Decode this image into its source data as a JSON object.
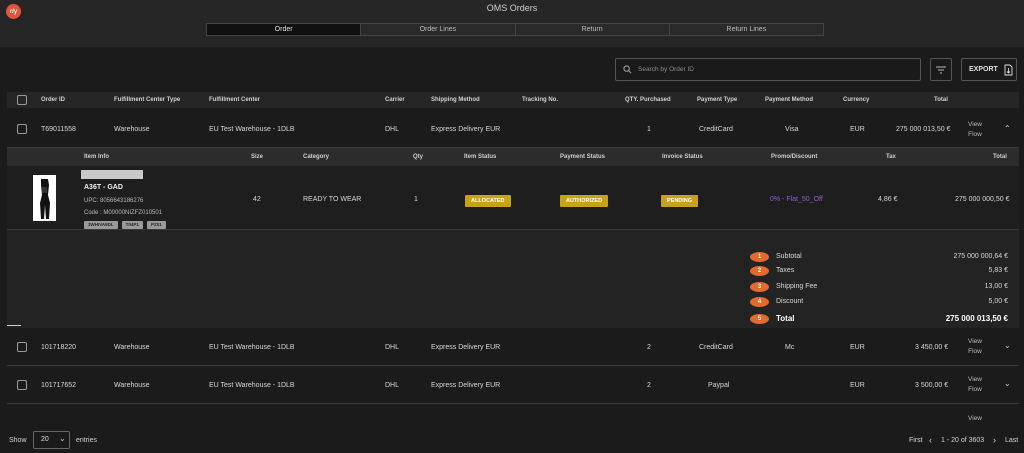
{
  "app": {
    "logo": "r/y",
    "title": "OMS Orders"
  },
  "tabs": [
    "Order",
    "Order Lines",
    "Return",
    "Return Lines"
  ],
  "search": {
    "placeholder": "Search by Order ID"
  },
  "export_label": "EXPORT",
  "columns": {
    "order_id": "Order ID",
    "fc_type": "Fulfillment Center Type",
    "fc": "Fulfillment Center",
    "carrier": "Carrier",
    "shipping": "Shipping Method",
    "tracking": "Tracking No.",
    "qty": "QTY. Purchased",
    "payment_type": "Payment Type",
    "payment_method": "Payment Method",
    "currency": "Currency",
    "total": "Total"
  },
  "orders": [
    {
      "id": "T69011558",
      "fc_type": "Warehouse",
      "fc": "EU Test Warehouse - 1DLB",
      "carrier": "DHL",
      "shipping": "Express Delivery EUR",
      "tracking": "",
      "qty": "1",
      "payment_type": "CreditCard",
      "payment_method": "Visa",
      "currency": "EUR",
      "total": "275 000 013,50 €",
      "action1": "View",
      "action2": "Flow"
    },
    {
      "id": "101718220",
      "fc_type": "Warehouse",
      "fc": "EU Test Warehouse - 1DLB",
      "carrier": "DHL",
      "shipping": "Express Delivery EUR",
      "tracking": "",
      "qty": "2",
      "payment_type": "CreditCard",
      "payment_method": "Mc",
      "currency": "EUR",
      "total": "3 450,00 €",
      "action1": "View",
      "action2": "Flow"
    },
    {
      "id": "101717652",
      "fc_type": "Warehouse",
      "fc": "EU Test Warehouse - 1DLB",
      "carrier": "DHL",
      "shipping": "Express Delivery EUR",
      "tracking": "",
      "qty": "2",
      "payment_type": "Paypal",
      "payment_method": "",
      "currency": "EUR",
      "total": "3 500,00 €",
      "action1": "View",
      "action2": "Flow"
    }
  ],
  "partial_row_action": "View",
  "line_columns": {
    "item_info": "Item Info",
    "size": "Size",
    "category": "Category",
    "qty": "Qty",
    "item_status": "Item Status",
    "payment_status": "Payment Status",
    "invoice_status": "Invoice Status",
    "promo": "Promo/Discount",
    "tax": "Tax",
    "total": "Total"
  },
  "line": {
    "name": "A36T - GAD",
    "upc": "UPC: 8056643186276",
    "code": "Code : M00000NIZFZ010501",
    "tags": [
      "3WHIVA9DL",
      "T04P1",
      "PZ01"
    ],
    "size": "42",
    "category": "READY TO WEAR",
    "qty": "1",
    "item_status": "ALLOCATED",
    "payment_status": "AUTHORIZED",
    "invoice_status": "PENDING",
    "promo": "0% - Flat_50_Off",
    "tax": "4,86 €",
    "total": "275 000 000,50 €"
  },
  "summary": [
    {
      "num": "1",
      "label": "Subtotal",
      "value": "275 000 000,64 €"
    },
    {
      "num": "2",
      "label": "Taxes",
      "value": "5,83 €"
    },
    {
      "num": "3",
      "label": "Shipping Fee",
      "value": "13,00 €"
    },
    {
      "num": "4",
      "label": "Discount",
      "value": "5,00 €"
    },
    {
      "num": "5",
      "label": "Total",
      "value": "275 000 013,50 €"
    }
  ],
  "footer": {
    "show": "Show",
    "page_size": "20",
    "entries": "entries",
    "first": "First",
    "range": "1 - 20 of 3603",
    "last": "Last"
  },
  "colors": {
    "accent": "#c9a21a",
    "badge_orange": "#e36a2c",
    "promo": "#9b59d0",
    "logo": "#e2553a"
  }
}
